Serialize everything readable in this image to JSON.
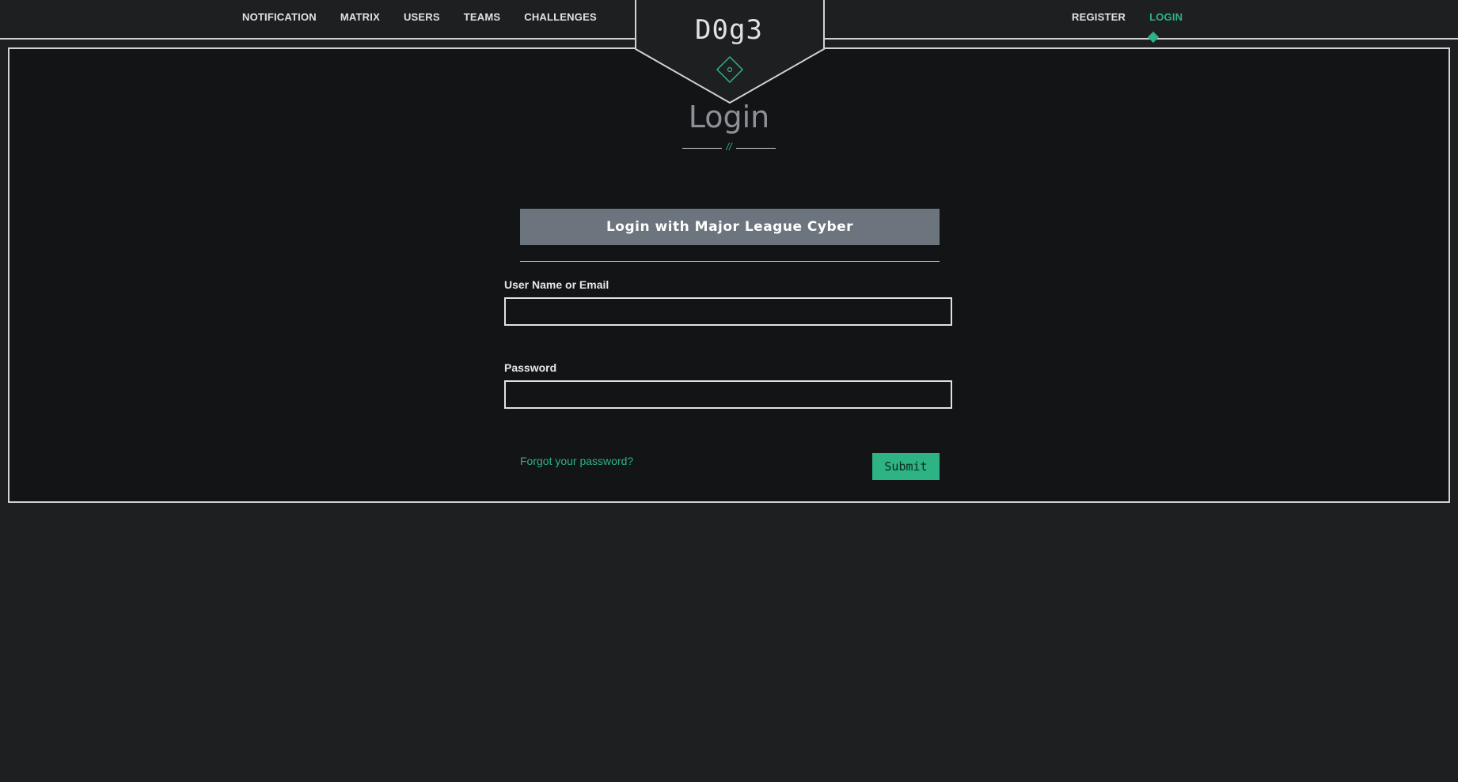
{
  "nav": {
    "left_items": [
      "NOTIFICATION",
      "MATRIX",
      "USERS",
      "TEAMS",
      "CHALLENGES"
    ],
    "right_items": [
      "REGISTER",
      "LOGIN"
    ],
    "active": "LOGIN"
  },
  "brand": {
    "name": "D0g3"
  },
  "page": {
    "title": "Login",
    "divider_glyph": "//"
  },
  "form": {
    "mlc_button_label": "Login with Major League Cyber",
    "username_label": "User Name or Email",
    "username_value": "",
    "password_label": "Password",
    "password_value": "",
    "forgot_label": "Forgot your password?",
    "submit_label": "Submit"
  },
  "colors": {
    "accent": "#2db384",
    "background": "#1e1f21",
    "panel": "#131416",
    "mlc_button": "#6c757d"
  }
}
